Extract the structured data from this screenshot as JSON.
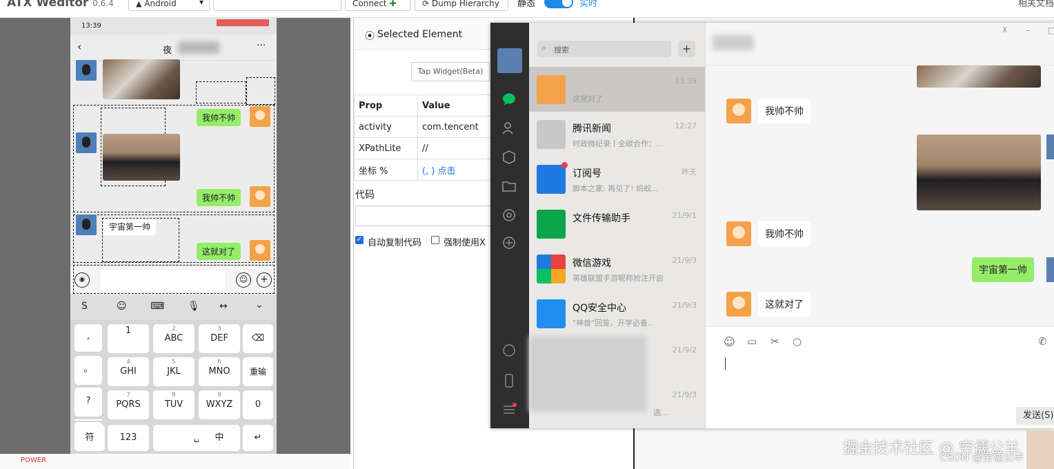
{
  "app": {
    "title": "ATX Weditor",
    "version": "0.6.4"
  },
  "toolbar": {
    "platform": "Android",
    "connect_label": "Connect",
    "dump_label": "Dump Hierarchy",
    "static_label": "静态",
    "realtime_label": "实时",
    "docs_label": "相关文档"
  },
  "phone": {
    "status_time": "13:39",
    "header_title": "夜",
    "messages": [
      "我帅不帅",
      "我帅不帅",
      "宇宙第一帅",
      "这就对了"
    ],
    "keys": [
      {
        "top": "",
        "main": "1"
      },
      {
        "top": "2",
        "main": "ABC"
      },
      {
        "top": "3",
        "main": "DEF"
      },
      {
        "top": "4",
        "main": "GHI"
      },
      {
        "top": "5",
        "main": "JKL"
      },
      {
        "top": "6",
        "main": "MNO"
      },
      {
        "top": "7",
        "main": "PQRS"
      },
      {
        "top": "8",
        "main": "TUV"
      },
      {
        "top": "9",
        "main": "WXYZ"
      }
    ],
    "side_keys": [
      ",",
      "。",
      "?",
      "!"
    ],
    "re_input": "重输",
    "zero": "0",
    "bottom_keys": {
      "sym": "符",
      "num": "123",
      "lang": "中"
    }
  },
  "panel": {
    "title": "Selected Element",
    "tap_label": "Tap Widget(Beta)",
    "headers": [
      "Prop",
      "Value"
    ],
    "rows": [
      [
        "activity",
        "com.tencent"
      ],
      [
        "XPathLite",
        "//"
      ],
      [
        "坐标 %",
        "(, ) 点击"
      ]
    ],
    "code_label": "代码",
    "check1": "自动复制代码",
    "check2": "强制使用X"
  },
  "wechat": {
    "search_placeholder": "搜索",
    "chats": [
      {
        "name": "",
        "time": "13:39",
        "preview": "这就对了"
      },
      {
        "name": "腾讯新闻",
        "time": "12:27",
        "preview": "时政微纪录丨全碳合作：..."
      },
      {
        "name": "订阅号",
        "time": "昨天",
        "preview": "脚本之家: 再见了! 蚂蚁..."
      },
      {
        "name": "文件传输助手",
        "time": "21/9/1",
        "preview": ""
      },
      {
        "name": "微信游戏",
        "time": "21/9/3",
        "preview": "英雄联盟手游昵称抢注开启"
      },
      {
        "name": "QQ安全中心",
        "time": "21/9/3",
        "preview": "\"神兽\"回笼，开学必备..."
      },
      {
        "name": "",
        "time": "21/9/2",
        "preview": ""
      },
      {
        "name": "",
        "time": "21/9/3",
        "preview": "选..."
      }
    ],
    "messages": [
      "我帅不帅",
      "我帅不帅",
      "宇宙第一帅",
      "这就对了"
    ],
    "send_label": "发送(S)"
  },
  "watermark": {
    "main": "掘金技术社区 @ 穷儒公羊",
    "sub": "CSDN @穷儒公羊"
  },
  "bottom": {
    "power": "POWER"
  }
}
